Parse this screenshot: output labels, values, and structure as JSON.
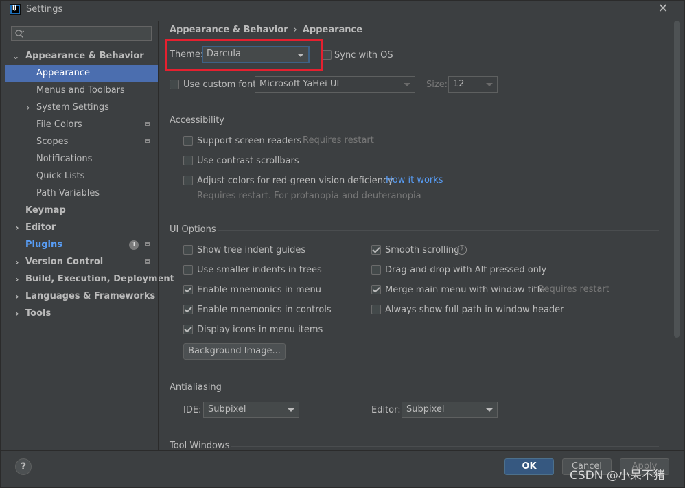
{
  "window": {
    "title": "Settings"
  },
  "search": {
    "placeholder": ""
  },
  "sidebar": {
    "items": [
      {
        "label": "Appearance & Behavior"
      },
      {
        "label": "Appearance"
      },
      {
        "label": "Menus and Toolbars"
      },
      {
        "label": "System Settings"
      },
      {
        "label": "File Colors"
      },
      {
        "label": "Scopes"
      },
      {
        "label": "Notifications"
      },
      {
        "label": "Quick Lists"
      },
      {
        "label": "Path Variables"
      },
      {
        "label": "Keymap"
      },
      {
        "label": "Editor"
      },
      {
        "label": "Plugins",
        "badge": "1"
      },
      {
        "label": "Version Control"
      },
      {
        "label": "Build, Execution, Deployment"
      },
      {
        "label": "Languages & Frameworks"
      },
      {
        "label": "Tools"
      }
    ]
  },
  "breadcrumb": {
    "parent": "Appearance & Behavior",
    "separator": "›",
    "current": "Appearance"
  },
  "theme": {
    "label": "Theme:",
    "value": "Darcula",
    "sync_label": "Sync with OS"
  },
  "font": {
    "custom_label": "Use custom font:",
    "value": "Microsoft YaHei UI",
    "size_label": "Size:",
    "size_value": "12"
  },
  "accessibility": {
    "title": "Accessibility",
    "screen_readers": "Support screen readers",
    "screen_readers_note": "Requires restart",
    "contrast_scrollbars": "Use contrast scrollbars",
    "adjust_colors": "Adjust colors for red-green vision deficiency",
    "how_it_works": "How it works",
    "adjust_note": "Requires restart. For protanopia and deuteranopia"
  },
  "ui_options": {
    "title": "UI Options",
    "left": [
      {
        "label": "Show tree indent guides",
        "checked": false
      },
      {
        "label": "Use smaller indents in trees",
        "checked": false
      },
      {
        "label": "Enable mnemonics in menu",
        "checked": true
      },
      {
        "label": "Enable mnemonics in controls",
        "checked": true
      },
      {
        "label": "Display icons in menu items",
        "checked": true
      }
    ],
    "right": [
      {
        "label": "Smooth scrolling",
        "checked": true
      },
      {
        "label": "Drag-and-drop with Alt pressed only",
        "checked": false
      },
      {
        "label": "Merge main menu with window title",
        "checked": true,
        "note": "Requires restart"
      },
      {
        "label": "Always show full path in window header",
        "checked": false
      }
    ],
    "background_button": "Background Image..."
  },
  "antialiasing": {
    "title": "Antialiasing",
    "ide_label": "IDE:",
    "ide_value": "Subpixel",
    "editor_label": "Editor:",
    "editor_value": "Subpixel"
  },
  "tool_windows": {
    "title": "Tool Windows"
  },
  "footer": {
    "help": "?",
    "ok": "OK",
    "cancel": "Cancel",
    "apply": "Apply"
  },
  "watermark": "CSDN @小呆不猪",
  "colors": {
    "accent": "#4b6eaf",
    "highlight": "#e5202f",
    "link": "#589df6",
    "ok_button": "#365880"
  }
}
